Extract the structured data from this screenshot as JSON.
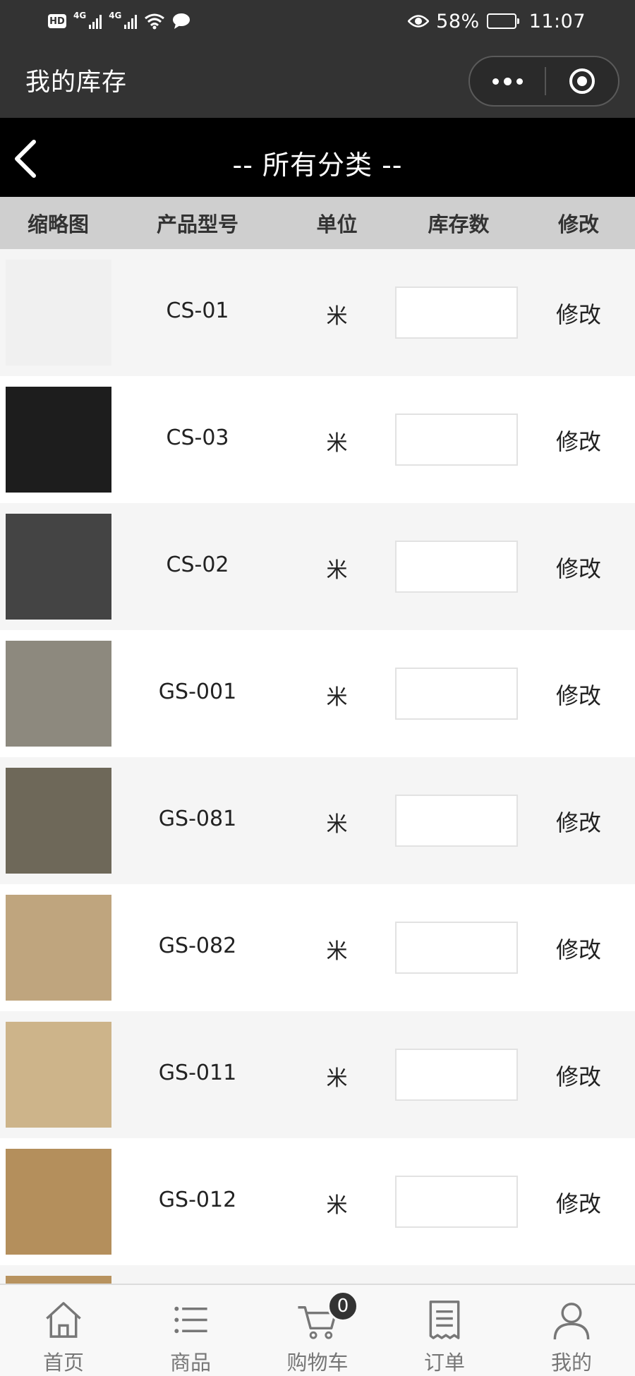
{
  "status_bar": {
    "hd_label": "HD",
    "sim1_label": "4G",
    "sim2_label": "4G",
    "battery_percent": "58%",
    "battery_level": 0.58,
    "time": "11:07"
  },
  "app": {
    "title": "我的库存"
  },
  "category": {
    "title": "-- 所有分类 --"
  },
  "table": {
    "headers": {
      "thumbnail": "缩略图",
      "model": "产品型号",
      "unit": "单位",
      "stock": "库存数",
      "edit": "修改"
    },
    "rows": [
      {
        "model": "CS-01",
        "unit": "米",
        "stock": "",
        "edit": "修改",
        "swatch": "#f0f0f0"
      },
      {
        "model": "CS-03",
        "unit": "米",
        "stock": "",
        "edit": "修改",
        "swatch": "#1d1d1d"
      },
      {
        "model": "CS-02",
        "unit": "米",
        "stock": "",
        "edit": "修改",
        "swatch": "#444444"
      },
      {
        "model": "GS-001",
        "unit": "米",
        "stock": "",
        "edit": "修改",
        "swatch": "#8d897e"
      },
      {
        "model": "GS-081",
        "unit": "米",
        "stock": "",
        "edit": "修改",
        "swatch": "#6e6859"
      },
      {
        "model": "GS-082",
        "unit": "米",
        "stock": "",
        "edit": "修改",
        "swatch": "#bfa57e"
      },
      {
        "model": "GS-011",
        "unit": "米",
        "stock": "",
        "edit": "修改",
        "swatch": "#cdb48a"
      },
      {
        "model": "GS-012",
        "unit": "米",
        "stock": "",
        "edit": "修改",
        "swatch": "#b48f5c"
      }
    ],
    "partial_row_swatch": "#b8935f"
  },
  "tabbar": {
    "items": [
      {
        "label": "首页",
        "icon": "home-icon"
      },
      {
        "label": "商品",
        "icon": "list-icon"
      },
      {
        "label": "购物车",
        "icon": "cart-icon",
        "badge": "0"
      },
      {
        "label": "订单",
        "icon": "receipt-icon"
      },
      {
        "label": "我的",
        "icon": "user-icon"
      }
    ]
  },
  "colors": {
    "header_bg": "#333333",
    "category_bg": "#000000",
    "table_header_bg": "#cfcfcf",
    "row_alt_bg": "#f5f5f5"
  }
}
